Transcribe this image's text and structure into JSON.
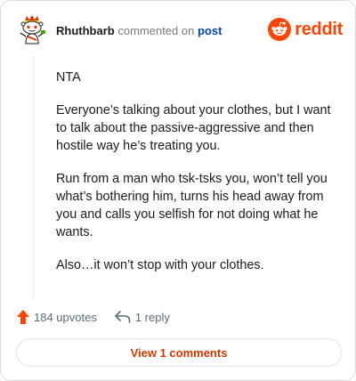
{
  "comment": {
    "username": "Rhuthbarb",
    "action_text": "commented on",
    "post_link": "post",
    "avatar_icon": "snoo-avatar-icon",
    "paragraphs": [
      "NTA",
      "Everyone’s talking about your clothes, but I want to talk about the passive-aggressive and then hostile way he’s treating you.",
      "Run from a man who tsk-tsks you, won’t tell you what’s bothering him, turns his head away from you and calls you selfish for not doing what he wants.",
      "Also…it won’t stop with your clothes."
    ]
  },
  "brand": {
    "name": "reddit",
    "icon": "reddit-logo-icon",
    "color": "#ff4500"
  },
  "actions": {
    "upvotes": "184 upvotes",
    "upvote_icon": "upvote-arrow-icon",
    "upvote_color": "#ff4500",
    "reply": "1 reply",
    "reply_icon": "reply-arrow-icon"
  },
  "footer": {
    "view_comments": "View 1 comments",
    "link_color": "#cc3700"
  }
}
